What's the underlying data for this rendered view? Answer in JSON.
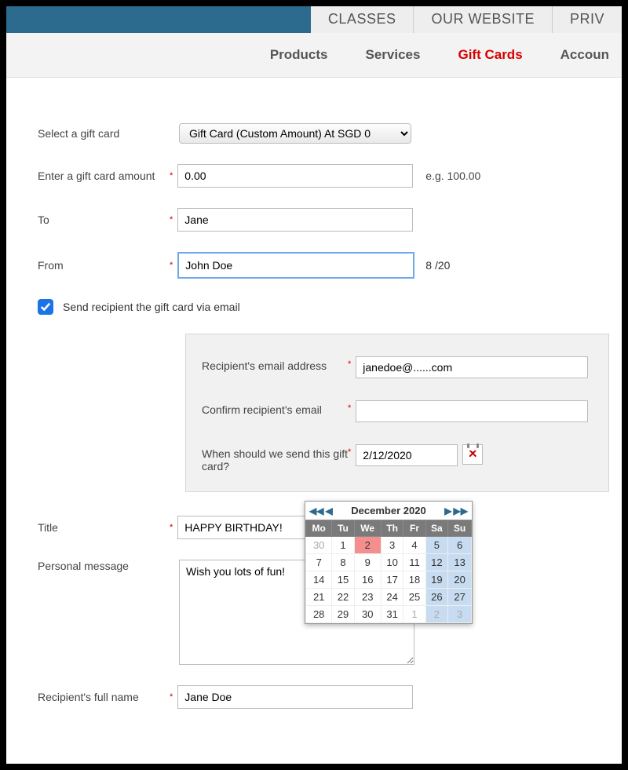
{
  "top_tabs": [
    "CLASSES",
    "OUR WEBSITE",
    "PRIV"
  ],
  "subnav": {
    "items": [
      "Products",
      "Services",
      "Gift Cards",
      "Accoun"
    ],
    "active_index": 2
  },
  "form": {
    "select_label": "Select a gift card",
    "select_value": "Gift Card (Custom Amount) At  SGD 0",
    "amount_label": "Enter a gift card amount",
    "amount_value": "0.00",
    "amount_hint": "e.g. 100.00",
    "to_label": "To",
    "to_value": "Jane",
    "from_label": "From",
    "from_value": "John Doe",
    "from_count": "8 /20",
    "send_email_label": "Send recipient the gift card via email",
    "send_email_checked": true,
    "email": {
      "recipient_label": "Recipient's email address",
      "recipient_value": "janedoe@......com",
      "confirm_label": "Confirm recipient's email",
      "confirm_value": "",
      "when_label": "When should we send this gift card?",
      "when_value": "2/12/2020"
    },
    "title_label": "Title",
    "title_value": "HAPPY BIRTHDAY!",
    "message_label": "Personal message",
    "message_value": "Wish you lots of fun!",
    "fullname_label": "Recipient's full name",
    "fullname_value": "Jane Doe"
  },
  "calendar": {
    "title": "December 2020",
    "dow": [
      "Mo",
      "Tu",
      "We",
      "Th",
      "Fr",
      "Sa",
      "Su"
    ],
    "weeks": [
      [
        {
          "d": 30,
          "o": true
        },
        {
          "d": 1
        },
        {
          "d": 2,
          "sel": true
        },
        {
          "d": 3
        },
        {
          "d": 4
        },
        {
          "d": 5,
          "we": true
        },
        {
          "d": 6,
          "we": true
        }
      ],
      [
        {
          "d": 7
        },
        {
          "d": 8
        },
        {
          "d": 9
        },
        {
          "d": 10
        },
        {
          "d": 11
        },
        {
          "d": 12,
          "we": true
        },
        {
          "d": 13,
          "we": true
        }
      ],
      [
        {
          "d": 14
        },
        {
          "d": 15
        },
        {
          "d": 16
        },
        {
          "d": 17
        },
        {
          "d": 18
        },
        {
          "d": 19,
          "we": true
        },
        {
          "d": 20,
          "we": true
        }
      ],
      [
        {
          "d": 21
        },
        {
          "d": 22
        },
        {
          "d": 23
        },
        {
          "d": 24
        },
        {
          "d": 25
        },
        {
          "d": 26,
          "we": true
        },
        {
          "d": 27,
          "we": true
        }
      ],
      [
        {
          "d": 28
        },
        {
          "d": 29
        },
        {
          "d": 30
        },
        {
          "d": 31
        },
        {
          "d": 1,
          "o": true
        },
        {
          "d": 2,
          "o": true,
          "we": true
        },
        {
          "d": 3,
          "o": true,
          "we": true
        }
      ]
    ]
  }
}
